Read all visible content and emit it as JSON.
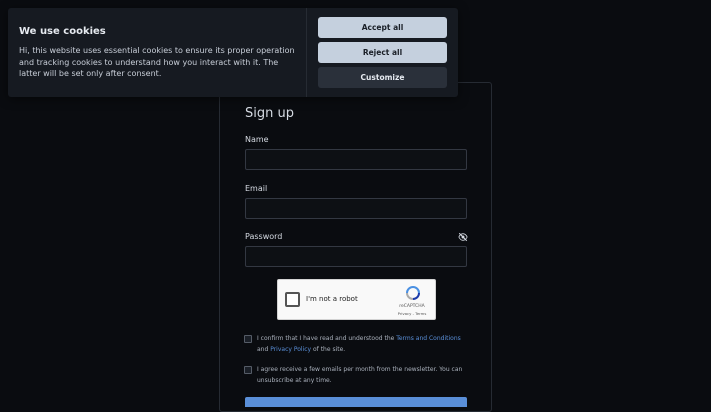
{
  "cookie_banner": {
    "title": "We use cookies",
    "text": "Hi, this website uses essential cookies to ensure its proper operation and tracking cookies to understand how you interact with it. The latter will be set only after consent.",
    "accept_label": "Accept all",
    "reject_label": "Reject all",
    "customize_label": "Customize"
  },
  "signup": {
    "title": "Sign up",
    "name_label": "Name",
    "name_value": "",
    "email_label": "Email",
    "email_value": "",
    "password_label": "Password",
    "password_value": ""
  },
  "recaptcha": {
    "label": "I'm not a robot",
    "brand": "reCAPTCHA",
    "links": "Privacy - Terms"
  },
  "consent": {
    "terms_prefix": "I confirm that I have read and understood the ",
    "terms_link": "Terms and Conditions",
    "terms_mid": " and ",
    "privacy_link": "Privacy Policy",
    "terms_suffix": " of the site.",
    "newsletter_text": "I agree receive a few emails per month from the newsletter. You can unsubscribe at any time."
  },
  "colors": {
    "background": "#0a0c10",
    "accent": "#5a8fd8",
    "banner": "#161a21"
  },
  "icons": {
    "password_toggle": "eye-slash-icon",
    "recaptcha_logo": "recaptcha-logo-icon"
  }
}
